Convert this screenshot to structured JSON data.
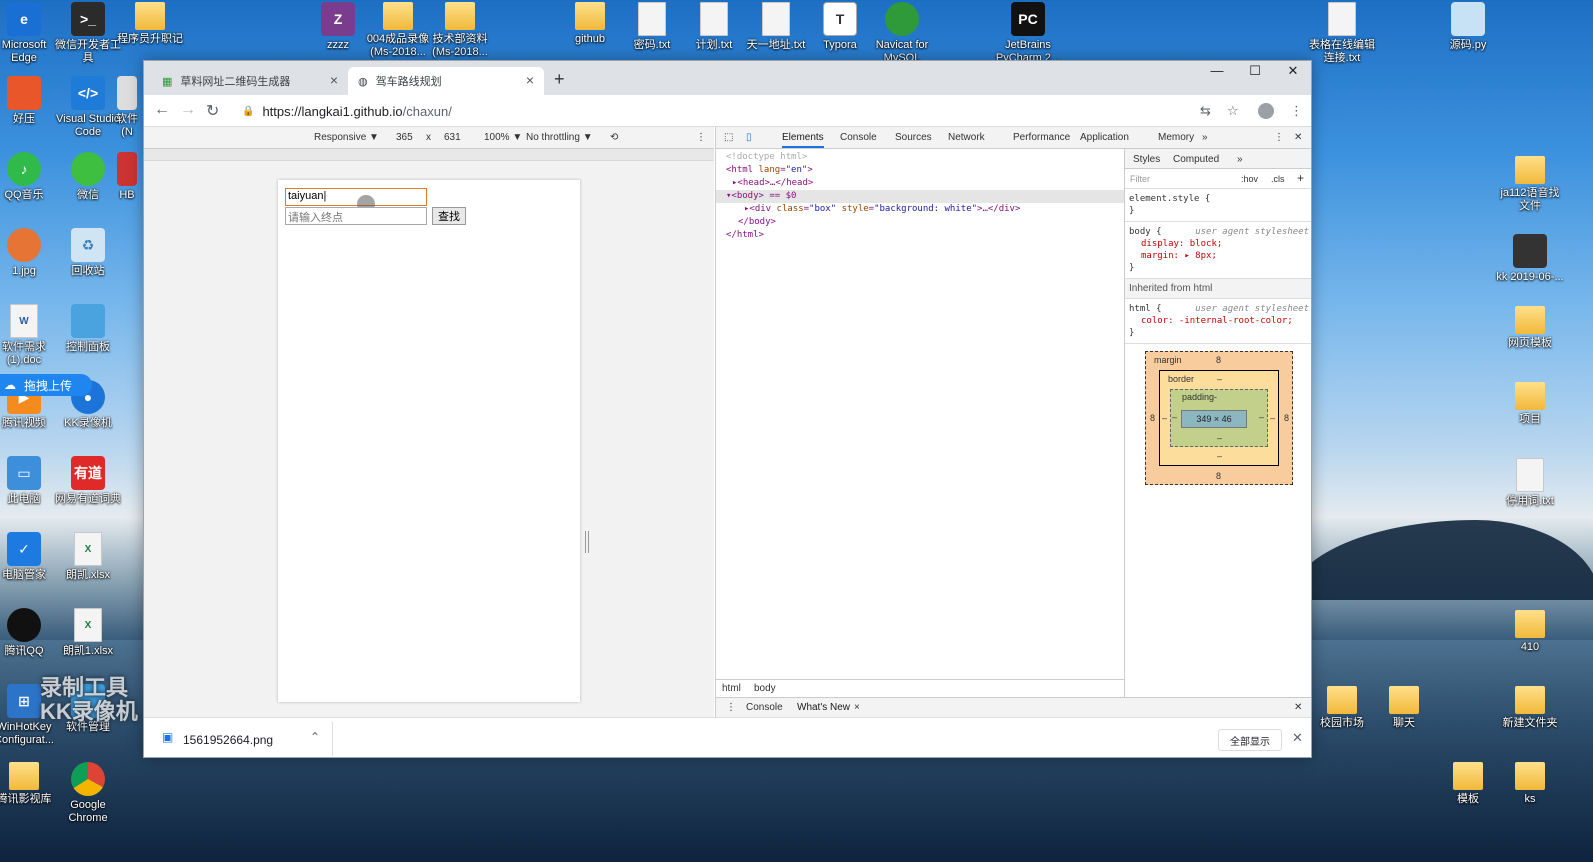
{
  "desktop": {
    "top_icons": [
      {
        "label": "Microsoft Edge",
        "kind": "edge"
      },
      {
        "label": "微信开发者工具",
        "kind": "app"
      },
      {
        "label": "程序员升职记",
        "kind": "folder"
      },
      {
        "label": "zzzz",
        "kind": "app"
      },
      {
        "label": "004成品录像 (Ms-2018...",
        "kind": "folder"
      },
      {
        "label": "技术部资料 (Ms-2018...",
        "kind": "folder"
      },
      {
        "label": "github",
        "kind": "folder"
      },
      {
        "label": "密码.txt",
        "kind": "file"
      },
      {
        "label": "计划.txt",
        "kind": "file"
      },
      {
        "label": "天一地址.txt",
        "kind": "file"
      },
      {
        "label": "Typora",
        "kind": "app"
      },
      {
        "label": "Navicat for MySQL",
        "kind": "app"
      },
      {
        "label": "JetBrains PyCharm 2...",
        "kind": "app"
      },
      {
        "label": "表格在线编辑 连接.txt",
        "kind": "file"
      },
      {
        "label": "源码.py",
        "kind": "file"
      }
    ],
    "left_icons": [
      {
        "label": "好压"
      },
      {
        "label": "Visual Studio Code"
      },
      {
        "label": "软件(N"
      },
      {
        "label": "QQ音乐"
      },
      {
        "label": "微信"
      },
      {
        "label": "HB"
      },
      {
        "label": "1.jpg"
      },
      {
        "label": "回收站"
      },
      {
        "label": "软件需求 (1).doc"
      },
      {
        "label": "控制面板"
      },
      {
        "label": "腾讯视频"
      },
      {
        "label": "KK录像机"
      },
      {
        "label": "此电脑"
      },
      {
        "label": "网易有道词典"
      },
      {
        "label": "电脑管家"
      },
      {
        "label": "朗凯.xlsx"
      },
      {
        "label": "腾讯QQ"
      },
      {
        "label": "朗凯1.xlsx"
      },
      {
        "label": "WinHotKey Configurat..."
      },
      {
        "label": "软件管理"
      },
      {
        "label": "腾讯影视库"
      },
      {
        "label": "Google Chrome"
      }
    ],
    "right_icons": [
      {
        "label": "ja112语音找 文件"
      },
      {
        "label": "kk 2019-06-..."
      },
      {
        "label": "网页模板"
      },
      {
        "label": "项目"
      },
      {
        "label": "停用词.txt"
      },
      {
        "label": "410"
      },
      {
        "label": "校园市场"
      },
      {
        "label": "聊天"
      },
      {
        "label": "新建文件夹"
      },
      {
        "label": "模板"
      },
      {
        "label": "ks"
      }
    ],
    "upload_pill": "拖拽上传",
    "watermark_line1": "录制工具",
    "watermark_line2": "KK录像机"
  },
  "browser": {
    "tabs": [
      {
        "title": "草料网址二维码生成器",
        "active": false
      },
      {
        "title": "驾车路线规划",
        "active": true
      }
    ],
    "url_host": "https://langkai1.github.io",
    "url_path": "/chaxun/",
    "device_toolbar": {
      "mode": "Responsive ▼",
      "width": "365",
      "times": "x",
      "height": "631",
      "zoom": "100% ▼",
      "throttling": "No throttling ▼"
    },
    "page": {
      "start_value": "taiyuan",
      "end_placeholder": "请输入终点",
      "search_button": "查找"
    },
    "devtools": {
      "tabs": [
        "Elements",
        "Console",
        "Sources",
        "Network",
        "Performance",
        "Application",
        "Memory",
        "»"
      ],
      "active_tab": "Elements",
      "dom": {
        "doctype": "<!doctype html>",
        "html_open": "<html",
        "html_attr": "lang",
        "html_val": "\"en\"",
        "head": "<head>…</head>",
        "body_line": "<body> == $0",
        "div_open": "<div",
        "div_attr1": "class",
        "div_val1": "\"box\"",
        "div_attr2": "style",
        "div_val2": "\"background: white\"",
        "div_close": ">…</div>",
        "body_close": "</body>",
        "html_close": "</html>"
      },
      "breadcrumbs": [
        "html",
        "body"
      ],
      "styles": {
        "tabs": [
          "Styles",
          "Computed",
          "»"
        ],
        "filter_placeholder": "Filter",
        "hov": ":hov",
        "cls": ".cls",
        "element_style": "element.style {",
        "close_brace": "}",
        "body_selector": "body {",
        "ua_label": "user agent stylesheet",
        "body_prop1": "display: block;",
        "body_prop2": "margin: ▸ 8px;",
        "inherited_from": "Inherited from",
        "inherited_tag": "html",
        "html_selector": "html {",
        "html_prop": "color: -internal-root-color;"
      },
      "box_model": {
        "margin_label": "margin",
        "margin_top": "8",
        "margin_bottom": "8",
        "margin_left": "8",
        "margin_right": "8",
        "border_label": "border",
        "border_value": "–",
        "padding_label": "padding-",
        "padding_value": "–",
        "content": "349 × 46"
      },
      "drawer_tabs": [
        "Console",
        "What's New"
      ]
    },
    "download": {
      "file": "1561952664.png",
      "show_all": "全部显示"
    }
  }
}
